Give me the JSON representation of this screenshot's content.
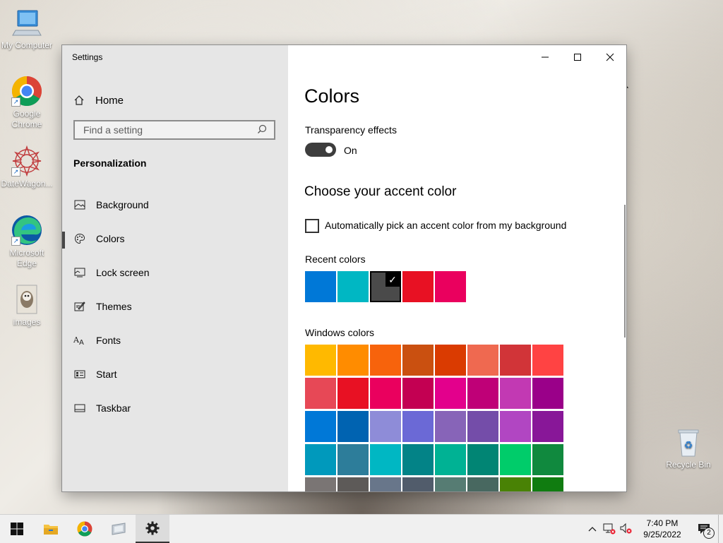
{
  "desktop": {
    "icons": [
      {
        "label": "My Computer",
        "icon": "computer-icon"
      },
      {
        "label": "Google Chrome",
        "icon": "chrome-icon"
      },
      {
        "label": "DateWagon...",
        "icon": "app-icon"
      },
      {
        "label": "Microsoft Edge",
        "icon": "edge-icon"
      },
      {
        "label": "images",
        "icon": "image-file-icon"
      },
      {
        "label": "Recycle Bin",
        "icon": "recycle-bin-icon"
      }
    ]
  },
  "window": {
    "title": "Settings",
    "nav": {
      "home_label": "Home",
      "search_placeholder": "Find a setting",
      "section_title": "Personalization",
      "items": [
        {
          "label": "Background",
          "icon": "picture-icon"
        },
        {
          "label": "Colors",
          "icon": "palette-icon",
          "active": true
        },
        {
          "label": "Lock screen",
          "icon": "lock-screen-icon"
        },
        {
          "label": "Themes",
          "icon": "themes-icon"
        },
        {
          "label": "Fonts",
          "icon": "fonts-icon"
        },
        {
          "label": "Start",
          "icon": "start-icon"
        },
        {
          "label": "Taskbar",
          "icon": "taskbar-icon"
        }
      ]
    },
    "content": {
      "page_title": "Colors",
      "transparency_label": "Transparency effects",
      "transparency_state": "On",
      "accent_heading": "Choose your accent color",
      "auto_pick_label": "Automatically pick an accent color from my background",
      "recent_label": "Recent colors",
      "recent_colors": [
        "#0078d7",
        "#00b7c3",
        "#4a4a4a",
        "#e81123",
        "#ea005e"
      ],
      "recent_selected": 2,
      "windows_label": "Windows colors",
      "windows_colors": [
        "#ffb900",
        "#ff8c00",
        "#f7630c",
        "#ca5010",
        "#da3b01",
        "#ef6950",
        "#d13438",
        "#ff4343",
        "#e74856",
        "#e81123",
        "#ea005e",
        "#c30052",
        "#e3008c",
        "#bf0077",
        "#c239b3",
        "#9a0089",
        "#0078d7",
        "#0063b1",
        "#8e8cd8",
        "#6b69d6",
        "#8764b8",
        "#744da9",
        "#b146c2",
        "#881798",
        "#0099bc",
        "#2d7d9a",
        "#00b7c3",
        "#038387",
        "#00b294",
        "#018574",
        "#00cc6a",
        "#10893e",
        "#7a7574",
        "#5d5a58",
        "#68768a",
        "#515c6b",
        "#567c73",
        "#486860",
        "#498205",
        "#107c10"
      ]
    }
  },
  "taskbar": {
    "apps": [
      "start-icon",
      "file-explorer-icon",
      "chrome-icon",
      "app-icon",
      "settings-icon"
    ],
    "time": "7:40 PM",
    "date": "9/25/2022",
    "notification_count": "2"
  }
}
